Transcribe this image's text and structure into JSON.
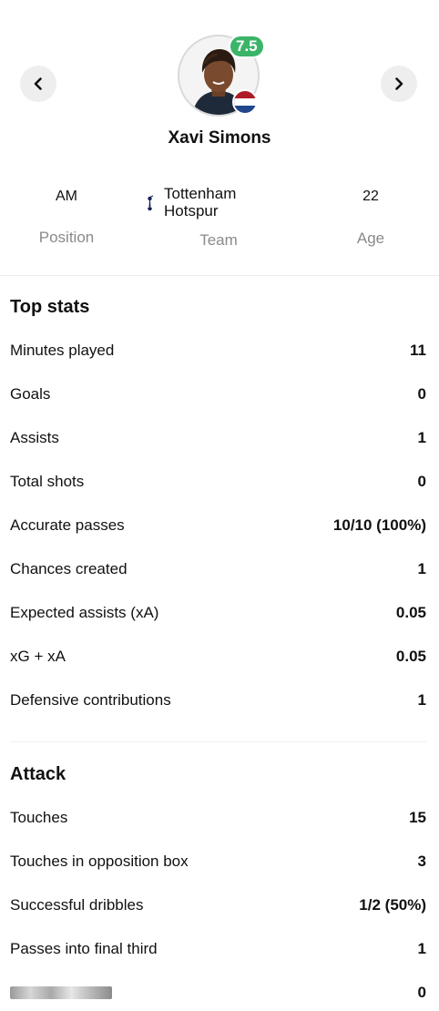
{
  "player": {
    "name": "Xavi Simons",
    "rating": "7.5",
    "rating_color": "#3bb46a",
    "flag_colors": [
      "#ae1c28",
      "#ffffff",
      "#21468b"
    ],
    "position_value": "AM",
    "position_label": "Position",
    "team_line1": "Tottenham",
    "team_line2": "Hotspur",
    "team_label": "Team",
    "age_value": "22",
    "age_label": "Age"
  },
  "nav": {
    "prev_icon": "chevron-left-icon",
    "next_icon": "chevron-right-icon"
  },
  "top_stats": {
    "title": "Top stats",
    "rows": [
      {
        "label": "Minutes played",
        "value": "11"
      },
      {
        "label": "Goals",
        "value": "0"
      },
      {
        "label": "Assists",
        "value": "1"
      },
      {
        "label": "Total shots",
        "value": "0"
      },
      {
        "label": "Accurate passes",
        "value": "10/10 (100%)"
      },
      {
        "label": "Chances created",
        "value": "1"
      },
      {
        "label": "Expected assists (xA)",
        "value": "0.05"
      },
      {
        "label": "xG + xA",
        "value": "0.05"
      },
      {
        "label": "Defensive contributions",
        "value": "1"
      }
    ]
  },
  "attack": {
    "title": "Attack",
    "rows": [
      {
        "label": "Touches",
        "value": "15"
      },
      {
        "label": "Touches in opposition box",
        "value": "3"
      },
      {
        "label": "Successful dribbles",
        "value": "1/2 (50%)"
      },
      {
        "label": "Passes into final third",
        "value": "1"
      },
      {
        "label": "",
        "value": "0"
      }
    ]
  }
}
